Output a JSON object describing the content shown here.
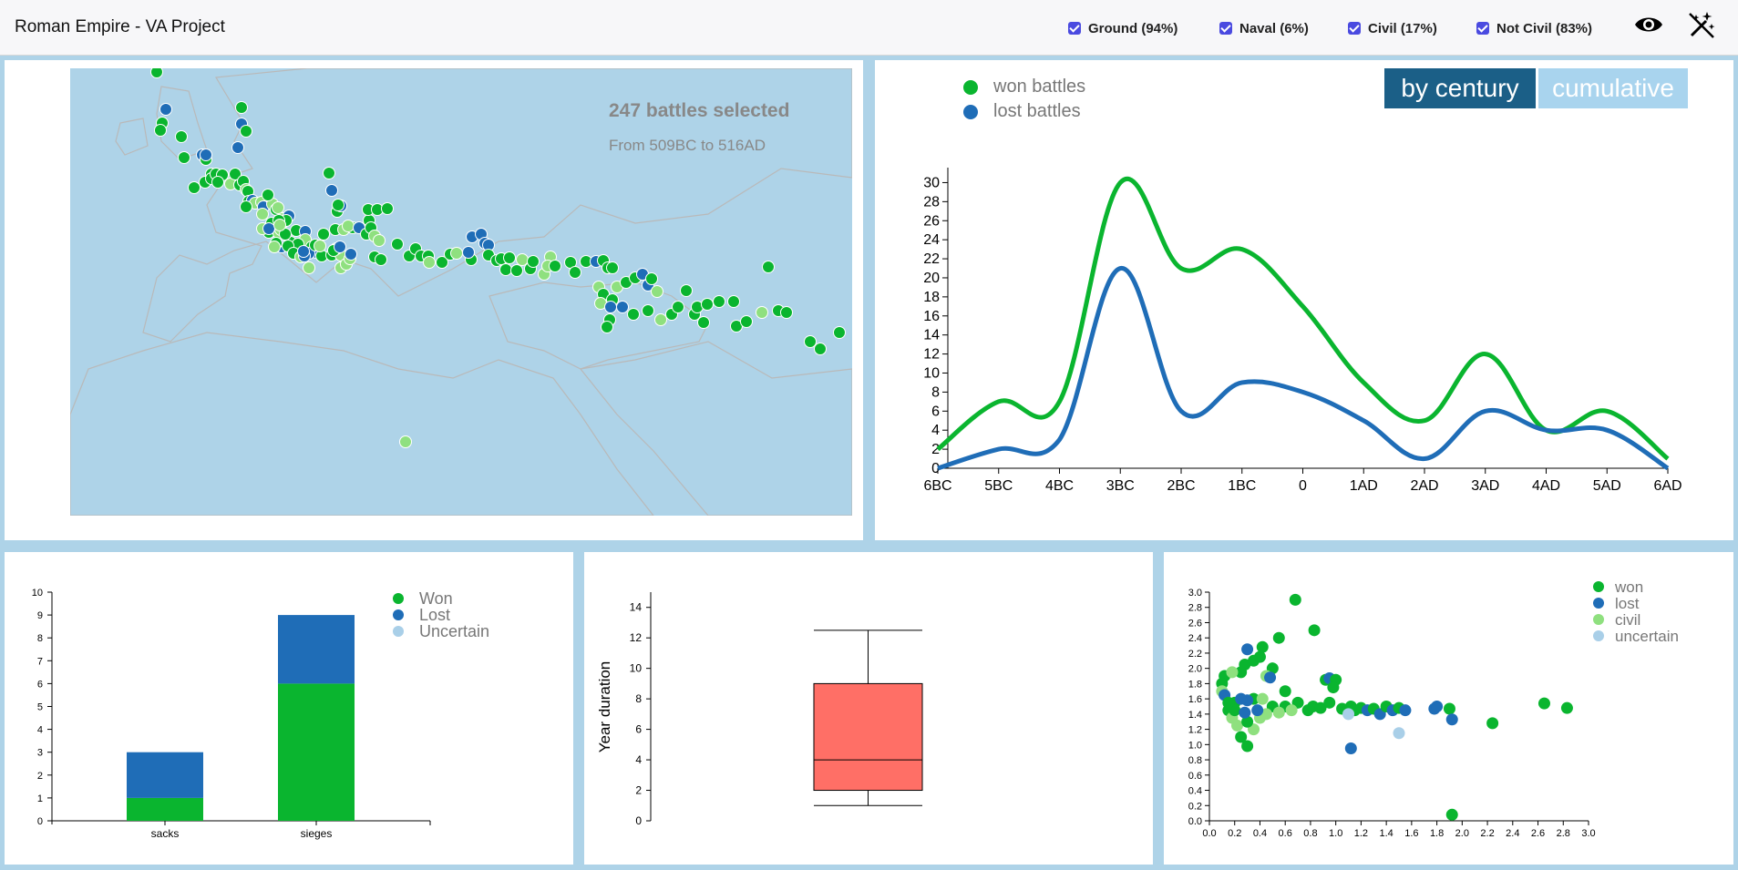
{
  "header": {
    "title": "Roman Empire - VA Project",
    "filters": [
      {
        "label": "Ground (94%)",
        "checked": true
      },
      {
        "label": "Naval (6%)",
        "checked": true
      },
      {
        "label": "Civil (17%)",
        "checked": true
      },
      {
        "label": "Not Civil (83%)",
        "checked": true
      }
    ],
    "icons": [
      "eye-icon",
      "magic-wand-off-icon"
    ]
  },
  "colors": {
    "won": "#0ab52f",
    "lost": "#1f6db7",
    "civil": "#8fe07f",
    "uncertain": "#a9cfe8",
    "box": "#ff6f66",
    "map_water": "#aed3e8"
  },
  "map": {
    "summary": "247 battles selected",
    "range": "From 509BC to 516AD"
  },
  "timeline": {
    "legend": [
      "won battles",
      "lost battles"
    ],
    "toggle": {
      "by_century": "by century",
      "cumulative": "cumulative",
      "active": "by century"
    }
  },
  "chart_data": [
    {
      "type": "line",
      "x": [
        "6BC",
        "5BC",
        "4BC",
        "3BC",
        "2BC",
        "1BC",
        "0",
        "1AD",
        "2AD",
        "3AD",
        "4AD",
        "5AD",
        "6AD"
      ],
      "series": [
        {
          "name": "won battles",
          "values": [
            2,
            7,
            7,
            30,
            21,
            23,
            17,
            9,
            5,
            12,
            4,
            6,
            1
          ]
        },
        {
          "name": "lost battles",
          "values": [
            0,
            2,
            3,
            21,
            6,
            9,
            8,
            5,
            1,
            6,
            4,
            4,
            0
          ]
        }
      ],
      "yticks": [
        0,
        2,
        4,
        6,
        8,
        10,
        12,
        14,
        16,
        18,
        20,
        22,
        24,
        26,
        28,
        30
      ],
      "ylim": [
        0,
        31
      ]
    },
    {
      "type": "bar",
      "categories": [
        "sacks",
        "sieges"
      ],
      "series": [
        {
          "name": "Won",
          "values": [
            1,
            6
          ]
        },
        {
          "name": "Lost",
          "values": [
            2,
            3
          ]
        },
        {
          "name": "Uncertain",
          "values": [
            0,
            0
          ]
        }
      ],
      "yticks": [
        0,
        1,
        2,
        3,
        4,
        5,
        6,
        7,
        8,
        9,
        10
      ],
      "ylim": [
        0,
        10
      ]
    },
    {
      "type": "box",
      "ylabel": "Year duration",
      "yticks": [
        0,
        2,
        4,
        6,
        8,
        10,
        12,
        14
      ],
      "ylim": [
        0,
        15
      ],
      "stats": {
        "min": 1,
        "q1": 2,
        "median": 4,
        "q3": 9,
        "max": 12.5
      }
    },
    {
      "type": "scatter",
      "legend": [
        "won",
        "lost",
        "civil",
        "uncertain"
      ],
      "xticks": [
        "0.0",
        "0.2",
        "0.4",
        "0.6",
        "0.8",
        "1.0",
        "1.2",
        "1.4",
        "1.6",
        "1.8",
        "2.0",
        "2.2",
        "2.4",
        "2.6",
        "2.8",
        "3.0"
      ],
      "yticks": [
        "0.0",
        "0.2",
        "0.4",
        "0.6",
        "0.8",
        "1.0",
        "1.2",
        "1.4",
        "1.6",
        "1.8",
        "2.0",
        "2.2",
        "2.4",
        "2.6",
        "2.8",
        "3.0"
      ],
      "xlim": [
        0,
        3
      ],
      "ylim": [
        0,
        3
      ],
      "points": [
        {
          "x": 0.68,
          "y": 2.9,
          "g": "won"
        },
        {
          "x": 0.83,
          "y": 2.5,
          "g": "won"
        },
        {
          "x": 0.55,
          "y": 2.4,
          "g": "won"
        },
        {
          "x": 0.3,
          "y": 2.25,
          "g": "lost"
        },
        {
          "x": 0.42,
          "y": 2.28,
          "g": "won"
        },
        {
          "x": 0.35,
          "y": 2.1,
          "g": "won"
        },
        {
          "x": 0.4,
          "y": 2.15,
          "g": "won"
        },
        {
          "x": 0.28,
          "y": 2.05,
          "g": "won"
        },
        {
          "x": 0.5,
          "y": 2.0,
          "g": "won"
        },
        {
          "x": 0.25,
          "y": 1.95,
          "g": "won"
        },
        {
          "x": 0.45,
          "y": 1.9,
          "g": "civil"
        },
        {
          "x": 0.12,
          "y": 1.9,
          "g": "won"
        },
        {
          "x": 0.18,
          "y": 1.95,
          "g": "civil"
        },
        {
          "x": 0.48,
          "y": 1.88,
          "g": "lost"
        },
        {
          "x": 0.92,
          "y": 1.85,
          "g": "won"
        },
        {
          "x": 0.95,
          "y": 1.87,
          "g": "lost"
        },
        {
          "x": 1.0,
          "y": 1.85,
          "g": "won"
        },
        {
          "x": 0.98,
          "y": 1.75,
          "g": "won"
        },
        {
          "x": 0.1,
          "y": 1.8,
          "g": "won"
        },
        {
          "x": 0.1,
          "y": 1.7,
          "g": "civil"
        },
        {
          "x": 0.12,
          "y": 1.65,
          "g": "lost"
        },
        {
          "x": 0.6,
          "y": 1.7,
          "g": "won"
        },
        {
          "x": 0.35,
          "y": 1.6,
          "g": "won"
        },
        {
          "x": 0.3,
          "y": 1.58,
          "g": "lost"
        },
        {
          "x": 0.2,
          "y": 1.55,
          "g": "won"
        },
        {
          "x": 0.25,
          "y": 1.6,
          "g": "lost"
        },
        {
          "x": 0.42,
          "y": 1.6,
          "g": "civil"
        },
        {
          "x": 0.5,
          "y": 1.5,
          "g": "won"
        },
        {
          "x": 0.6,
          "y": 1.5,
          "g": "won"
        },
        {
          "x": 0.7,
          "y": 1.55,
          "g": "won"
        },
        {
          "x": 0.78,
          "y": 1.45,
          "g": "won"
        },
        {
          "x": 0.82,
          "y": 1.5,
          "g": "won"
        },
        {
          "x": 0.88,
          "y": 1.48,
          "g": "won"
        },
        {
          "x": 0.95,
          "y": 1.55,
          "g": "won"
        },
        {
          "x": 1.05,
          "y": 1.47,
          "g": "won"
        },
        {
          "x": 1.12,
          "y": 1.5,
          "g": "won"
        },
        {
          "x": 1.15,
          "y": 1.45,
          "g": "won"
        },
        {
          "x": 1.2,
          "y": 1.48,
          "g": "won"
        },
        {
          "x": 1.25,
          "y": 1.45,
          "g": "lost"
        },
        {
          "x": 1.3,
          "y": 1.47,
          "g": "won"
        },
        {
          "x": 1.35,
          "y": 1.4,
          "g": "lost"
        },
        {
          "x": 1.4,
          "y": 1.5,
          "g": "won"
        },
        {
          "x": 1.45,
          "y": 1.45,
          "g": "lost"
        },
        {
          "x": 1.5,
          "y": 1.48,
          "g": "won"
        },
        {
          "x": 1.55,
          "y": 1.45,
          "g": "lost"
        },
        {
          "x": 1.78,
          "y": 1.47,
          "g": "lost"
        },
        {
          "x": 1.8,
          "y": 1.5,
          "g": "lost"
        },
        {
          "x": 1.9,
          "y": 1.47,
          "g": "won"
        },
        {
          "x": 1.92,
          "y": 1.33,
          "g": "lost"
        },
        {
          "x": 2.24,
          "y": 1.28,
          "g": "won"
        },
        {
          "x": 2.65,
          "y": 1.54,
          "g": "won"
        },
        {
          "x": 2.83,
          "y": 1.48,
          "g": "won"
        },
        {
          "x": 1.12,
          "y": 0.95,
          "g": "lost"
        },
        {
          "x": 1.5,
          "y": 1.15,
          "g": "uncertain"
        },
        {
          "x": 1.92,
          "y": 0.08,
          "g": "won"
        },
        {
          "x": 0.15,
          "y": 1.45,
          "g": "won"
        },
        {
          "x": 0.18,
          "y": 1.35,
          "g": "civil"
        },
        {
          "x": 0.22,
          "y": 1.25,
          "g": "civil"
        },
        {
          "x": 0.25,
          "y": 1.1,
          "g": "won"
        },
        {
          "x": 0.3,
          "y": 0.98,
          "g": "won"
        },
        {
          "x": 0.35,
          "y": 1.2,
          "g": "civil"
        },
        {
          "x": 0.3,
          "y": 1.3,
          "g": "won"
        },
        {
          "x": 0.4,
          "y": 1.35,
          "g": "civil"
        },
        {
          "x": 0.45,
          "y": 1.4,
          "g": "civil"
        },
        {
          "x": 0.2,
          "y": 1.45,
          "g": "won"
        },
        {
          "x": 0.28,
          "y": 1.42,
          "g": "lost"
        },
        {
          "x": 0.55,
          "y": 1.42,
          "g": "civil"
        },
        {
          "x": 0.65,
          "y": 1.45,
          "g": "civil"
        },
        {
          "x": 1.1,
          "y": 1.4,
          "g": "uncertain"
        },
        {
          "x": 0.15,
          "y": 1.55,
          "g": "won"
        },
        {
          "x": 0.38,
          "y": 1.45,
          "g": "lost"
        }
      ]
    }
  ]
}
